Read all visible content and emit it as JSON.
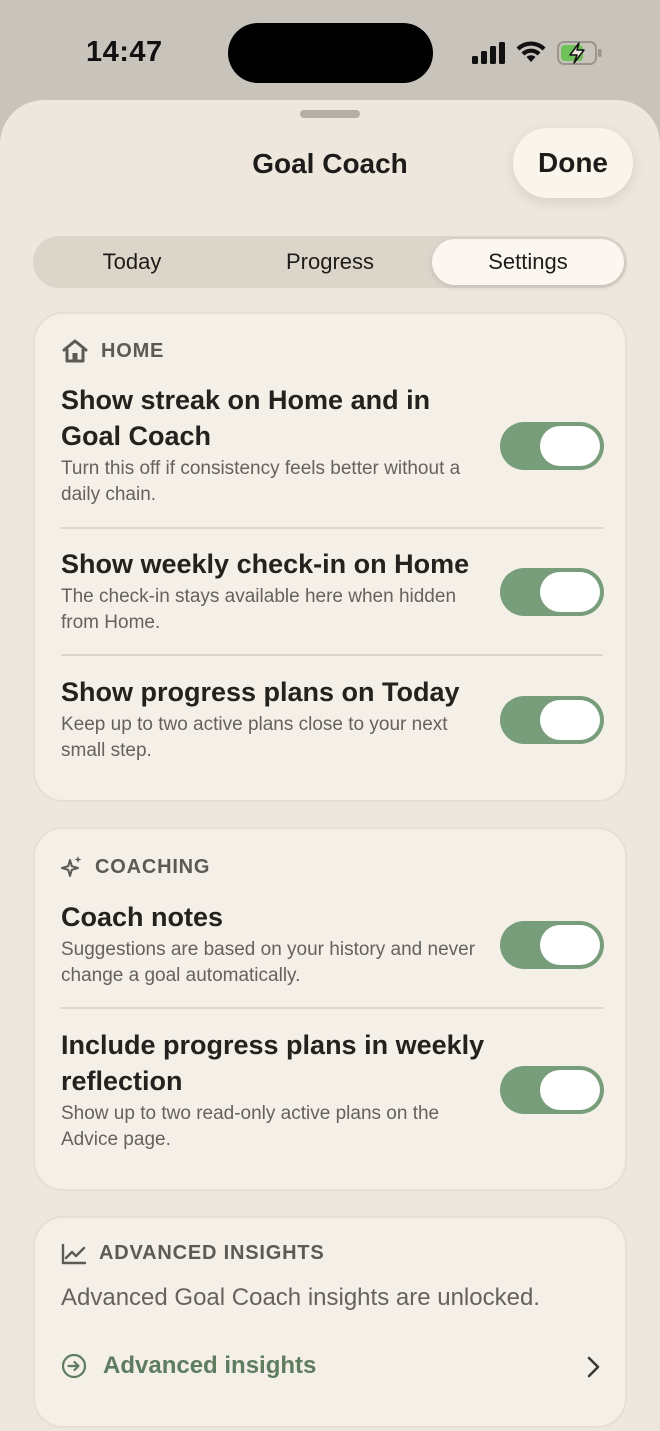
{
  "status_bar": {
    "time": "14:47"
  },
  "sheet": {
    "title": "Goal Coach",
    "done_label": "Done"
  },
  "tabs": [
    {
      "label": "Today",
      "active": false
    },
    {
      "label": "Progress",
      "active": false
    },
    {
      "label": "Settings",
      "active": true
    }
  ],
  "home_section": {
    "header": "HOME",
    "icon": "house-icon",
    "rows": [
      {
        "title": "Show streak on Home and in Goal Coach",
        "desc": "Turn this off if consistency feels better without a daily chain.",
        "on": true
      },
      {
        "title": "Show weekly check-in on Home",
        "desc": "The check-in stays available here when hidden from Home.",
        "on": true
      },
      {
        "title": "Show progress plans on Today",
        "desc": "Keep up to two active plans close to your next small step.",
        "on": true
      }
    ]
  },
  "coaching_section": {
    "header": "COACHING",
    "icon": "sparkle-icon",
    "rows": [
      {
        "title": "Coach notes",
        "desc": "Suggestions are based on your history and never change a goal automatically.",
        "on": true
      },
      {
        "title": "Include progress plans in weekly reflection",
        "desc": "Show up to two read-only active plans on the Advice page.",
        "on": true
      }
    ]
  },
  "insights_section": {
    "header": "ADVANCED INSIGHTS",
    "icon": "chart-line-icon",
    "text": "Advanced Goal Coach insights are unlocked.",
    "link_label": "Advanced insights",
    "link_icon": "arrow-circle-icon"
  },
  "colors": {
    "toggle_on": "#789d7b",
    "accent_link": "#5e7c5f",
    "sheet_bg": "#ede7dd",
    "card_bg": "#f4efe7"
  }
}
